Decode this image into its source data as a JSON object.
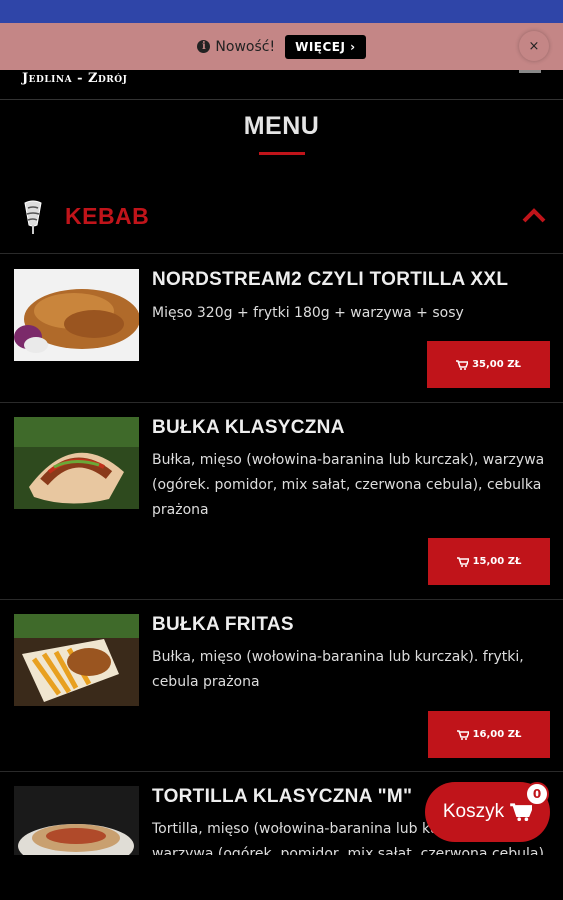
{
  "notice": {
    "text": "Nowość!",
    "button": "WIĘCEJ ›",
    "close": "×"
  },
  "header": {
    "logo": "Jedlina - Zdrój"
  },
  "menu": {
    "title": "MENU"
  },
  "category": {
    "name": "KEBAB"
  },
  "items": [
    {
      "name": "NORDSTREAM2 CZYLI TORTILLA XXL",
      "desc": "Mięso 320g + frytki 180g + warzywa + sosy",
      "price": "35,00 ZŁ"
    },
    {
      "name": "BUŁKA KLASYCZNA",
      "desc": "Bułka, mięso (wołowina-baranina lub kurczak), warzywa (ogórek. pomidor, mix sałat, czerwona cebula), cebulka prażona",
      "price": "15,00 ZŁ"
    },
    {
      "name": "BUŁKA FRITAS",
      "desc": "Bułka, mięso (wołowina-baranina lub kurczak). frytki, cebula prażona",
      "price": "16,00 ZŁ"
    },
    {
      "name": "TORTILLA KLASYCZNA \"M\"",
      "desc": "Tortilla, mięso (wołowina-baranina lub kurczak), warzywa (ogórek, pomidor, mix sałat, czerwona cebula)",
      "price": ""
    }
  ],
  "cart": {
    "label": "Koszyk",
    "count": "0"
  },
  "colors": {
    "accent": "#c0141a",
    "notice_bg": "#c48686",
    "status_bar": "#2f45a8",
    "background": "#000000"
  }
}
